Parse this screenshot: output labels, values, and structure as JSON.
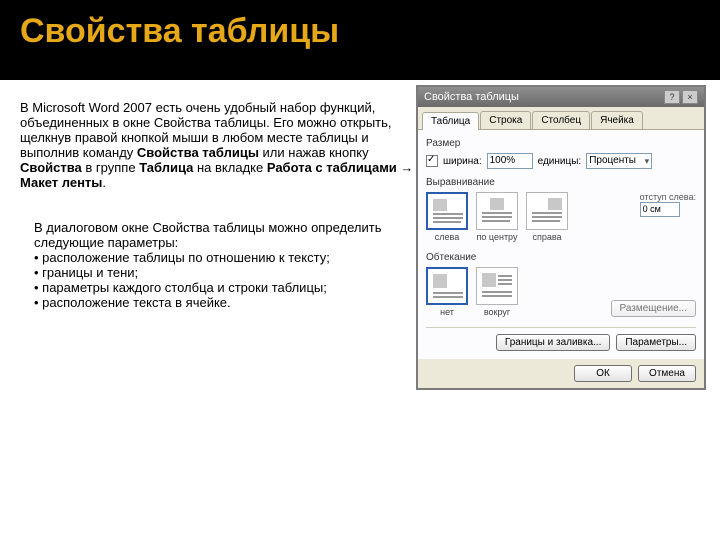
{
  "header": {
    "title": "Свойства таблицы"
  },
  "para1": {
    "t1": "В Microsoft Word 2007 есть очень удобный набор функций, объединенных в окне Свойства таблицы. Его можно открыть, щелкнув правой кнопкой мыши в любом месте таблицы и выполнив команду ",
    "b1": "Свойства таблицы",
    "t2": " или нажав кнопку ",
    "b2": "Свойства",
    "t3": " в группе ",
    "b3": "Таблица",
    "t4": " на вкладке ",
    "b4": "Работа с таблицами → Макет ленты",
    "t5": "."
  },
  "para2": {
    "intro": "В диалоговом окне Свойства таблицы можно определить следующие параметры:",
    "b1": "• расположение таблицы по отношению к тексту;",
    "b2": "• границы и тени;",
    "b3": "• параметры каждого столбца и строки таблицы;",
    "b4": "• расположение текста в ячейке."
  },
  "dialog": {
    "title": "Свойства таблицы",
    "help": "?",
    "close": "×",
    "tabs": {
      "table": "Таблица",
      "row": "Строка",
      "column": "Столбец",
      "cell": "Ячейка"
    },
    "size": {
      "group": "Размер",
      "width_chk": "ширина:",
      "width_val": "100%",
      "unit_lbl": "единицы:",
      "unit_val": "Проценты"
    },
    "align": {
      "group": "Выравнивание",
      "left": "слева",
      "center": "по центру",
      "right": "справа",
      "indent_lbl": "отступ слева:",
      "indent_val": "0 см"
    },
    "wrap": {
      "group": "Обтекание",
      "none": "нет",
      "around": "вокруг",
      "placement": "Размещение..."
    },
    "buttons": {
      "borders": "Границы и заливка...",
      "options": "Параметры...",
      "ok": "ОК",
      "cancel": "Отмена"
    }
  }
}
